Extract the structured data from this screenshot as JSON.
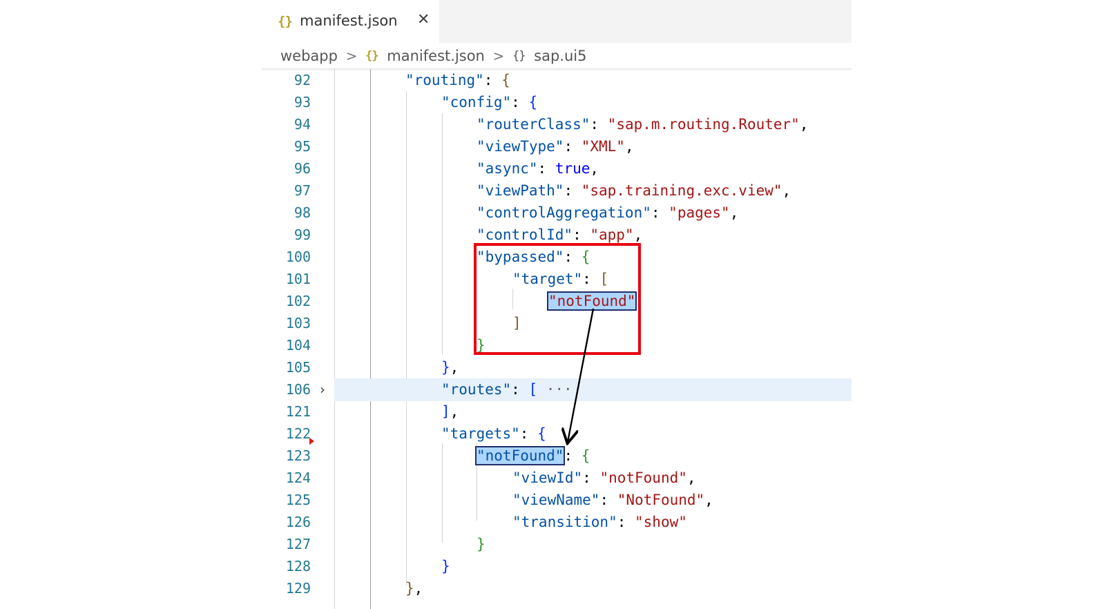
{
  "tab": {
    "icon": "json-braces-icon",
    "icon_glyph": "{}",
    "label": "manifest.json",
    "close_glyph": "✕"
  },
  "breadcrumb": {
    "folder": "webapp",
    "sep": ">",
    "file_glyph": "{}",
    "file": "manifest.json",
    "obj_glyph": "{}",
    "node": "sap.ui5"
  },
  "lines": [
    {
      "n": "92"
    },
    {
      "n": "93"
    },
    {
      "n": "94"
    },
    {
      "n": "95"
    },
    {
      "n": "96"
    },
    {
      "n": "97"
    },
    {
      "n": "98"
    },
    {
      "n": "99"
    },
    {
      "n": "100"
    },
    {
      "n": "101"
    },
    {
      "n": "102"
    },
    {
      "n": "103"
    },
    {
      "n": "104"
    },
    {
      "n": "105"
    },
    {
      "n": "106"
    },
    {
      "n": "121"
    },
    {
      "n": "122"
    },
    {
      "n": "123"
    },
    {
      "n": "124"
    },
    {
      "n": "125"
    },
    {
      "n": "126"
    },
    {
      "n": "127"
    },
    {
      "n": "128"
    },
    {
      "n": "129"
    }
  ],
  "code": {
    "routing": "\"routing\"",
    "config": "\"config\"",
    "routerClass": "\"routerClass\"",
    "routerClass_val": "\"sap.m.routing.Router\"",
    "viewType": "\"viewType\"",
    "viewType_val": "\"XML\"",
    "async": "\"async\"",
    "async_val": "true",
    "viewPath": "\"viewPath\"",
    "viewPath_val": "\"sap.training.exc.view\"",
    "controlAggregation": "\"controlAggregation\"",
    "controlAggregation_val": "\"pages\"",
    "controlId": "\"controlId\"",
    "controlId_val": "\"app\"",
    "bypassed": "\"bypassed\"",
    "target": "\"target\"",
    "target_val": "\"notFound\"",
    "routes": "\"routes\"",
    "routes_ellipsis": "···",
    "targets": "\"targets\"",
    "notFound": "\"notFound\"",
    "viewId": "\"viewId\"",
    "viewId_val": "\"notFound\"",
    "viewName": "\"viewName\"",
    "viewName_val": "\"NotFound\"",
    "transition": "\"transition\"",
    "transition_val": "\"show\""
  },
  "colors": {
    "key": "#0451a5",
    "string": "#a31515",
    "keyword": "#0000ff",
    "annotation_box": "#e8000f",
    "line_number": "#237893"
  }
}
